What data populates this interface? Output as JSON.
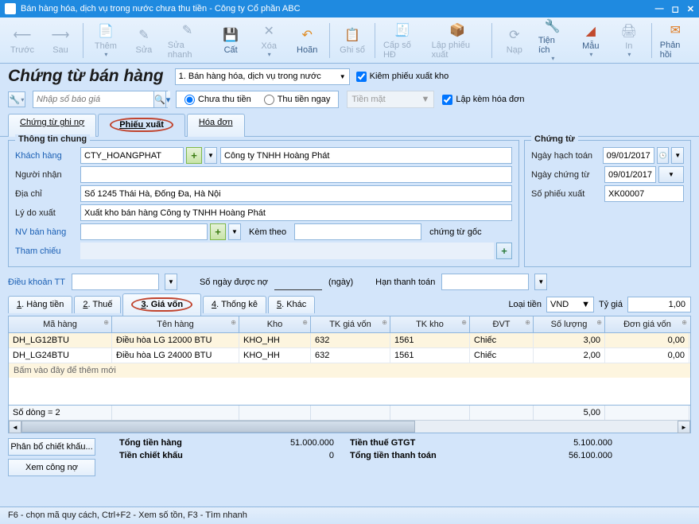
{
  "window": {
    "title": "Bán hàng hóa, dịch vụ trong nước chưa thu tiền - Công ty Cổ phần ABC"
  },
  "toolbar": {
    "prev": "Trước",
    "next": "Sau",
    "add": "Thêm",
    "edit": "Sửa",
    "quickedit": "Sửa nhanh",
    "cut": "Cất",
    "del": "Xóa",
    "undo": "Hoãn",
    "post": "Ghi sổ",
    "invno": "Cấp số HĐ",
    "issue": "Lập phiếu xuất",
    "load": "Nạp",
    "util": "Tiện ích",
    "template": "Mẫu",
    "print": "In",
    "feedback": "Phản hồi"
  },
  "header": {
    "title": "Chứng từ bán hàng",
    "type_combo": "1. Bán hàng hóa, dịch vụ trong nước",
    "chk_issue": "Kiêm phiếu xuất kho",
    "search_placeholder": "Nhập số báo giá",
    "radio_unpaid": "Chưa thu tiền",
    "radio_paidnow": "Thu tiền ngay",
    "payment_method": "Tiền mặt",
    "chk_invoice": "Lập kèm hóa đơn"
  },
  "doc_tabs": {
    "t1": "Chứng từ ghi nợ",
    "t2": "Phiếu xuất",
    "t3": "Hóa đơn"
  },
  "general": {
    "legend": "Thông tin chung",
    "l_customer": "Khách hàng",
    "customer_code": "CTY_HOANGPHAT",
    "customer_name": "Công ty TNHH Hoàng Phát",
    "l_receiver": "Người nhận",
    "receiver": "",
    "l_address": "Địa chỉ",
    "address": "Số 1245 Thái Hà, Đống Đa, Hà Nội",
    "l_reason": "Lý do xuất",
    "reason": "Xuất kho bán hàng Công ty TNHH Hoàng Phát",
    "l_sales": "NV bán hàng",
    "sales": "",
    "l_attach": "Kèm theo",
    "attach": "",
    "attach_suffix": "chứng từ gốc",
    "l_ref": "Tham chiếu"
  },
  "voucher": {
    "legend": "Chứng từ",
    "l_acdate": "Ngày hạch toán",
    "acdate": "09/01/2017",
    "l_vdate": "Ngày chứng từ",
    "vdate": "09/01/2017",
    "l_no": "Số phiếu xuất",
    "no": "XK00007"
  },
  "terms": {
    "l_term": "Điều khoản TT",
    "term": "",
    "l_days": "Số ngày được nợ",
    "days": "",
    "days_suffix": "(ngày)",
    "l_due": "Hạn thanh toán",
    "due": ""
  },
  "detail_tabs": {
    "t1": "1. Hàng tiền",
    "t2": "2. Thuế",
    "t3": "3. Giá vốn",
    "t4": "4. Thống kê",
    "t5": "5. Khác",
    "l_currency": "Loại tiền",
    "currency": "VND",
    "l_rate": "Tỷ giá",
    "rate": "1,00"
  },
  "grid": {
    "h1": "Mã hàng",
    "h2": "Tên hàng",
    "h3": "Kho",
    "h4": "TK giá vốn",
    "h5": "TK kho",
    "h6": "ĐVT",
    "h7": "Số lượng",
    "h8": "Đơn giá vốn",
    "rows": [
      {
        "code": "DH_LG12BTU",
        "name": "Điều hòa LG 12000 BTU",
        "store": "KHO_HH",
        "acc1": "632",
        "acc2": "1561",
        "unit": "Chiếc",
        "qty": "3,00",
        "price": "0,00"
      },
      {
        "code": "DH_LG24BTU",
        "name": "Điều hòa LG 24000 BTU",
        "store": "KHO_HH",
        "acc1": "632",
        "acc2": "1561",
        "unit": "Chiếc",
        "qty": "2,00",
        "price": "0,00"
      }
    ],
    "add_hint": "Bấm vào đây để thêm mới",
    "rowcount": "Số dòng = 2",
    "sum_qty": "5,00"
  },
  "totals": {
    "btn_discount": "Phân bổ chiết khấu...",
    "btn_debt": "Xem công nợ",
    "l_subtotal": "Tổng tiền hàng",
    "subtotal": "51.000.000",
    "l_discount": "Tiền chiết khấu",
    "discount": "0",
    "l_vat": "Tiền thuế GTGT",
    "vat": "5.100.000",
    "l_total": "Tổng tiền thanh toán",
    "total": "56.100.000"
  },
  "status": "F6 - chọn mã quy cách, Ctrl+F2 - Xem số tồn, F3 - Tìm nhanh"
}
